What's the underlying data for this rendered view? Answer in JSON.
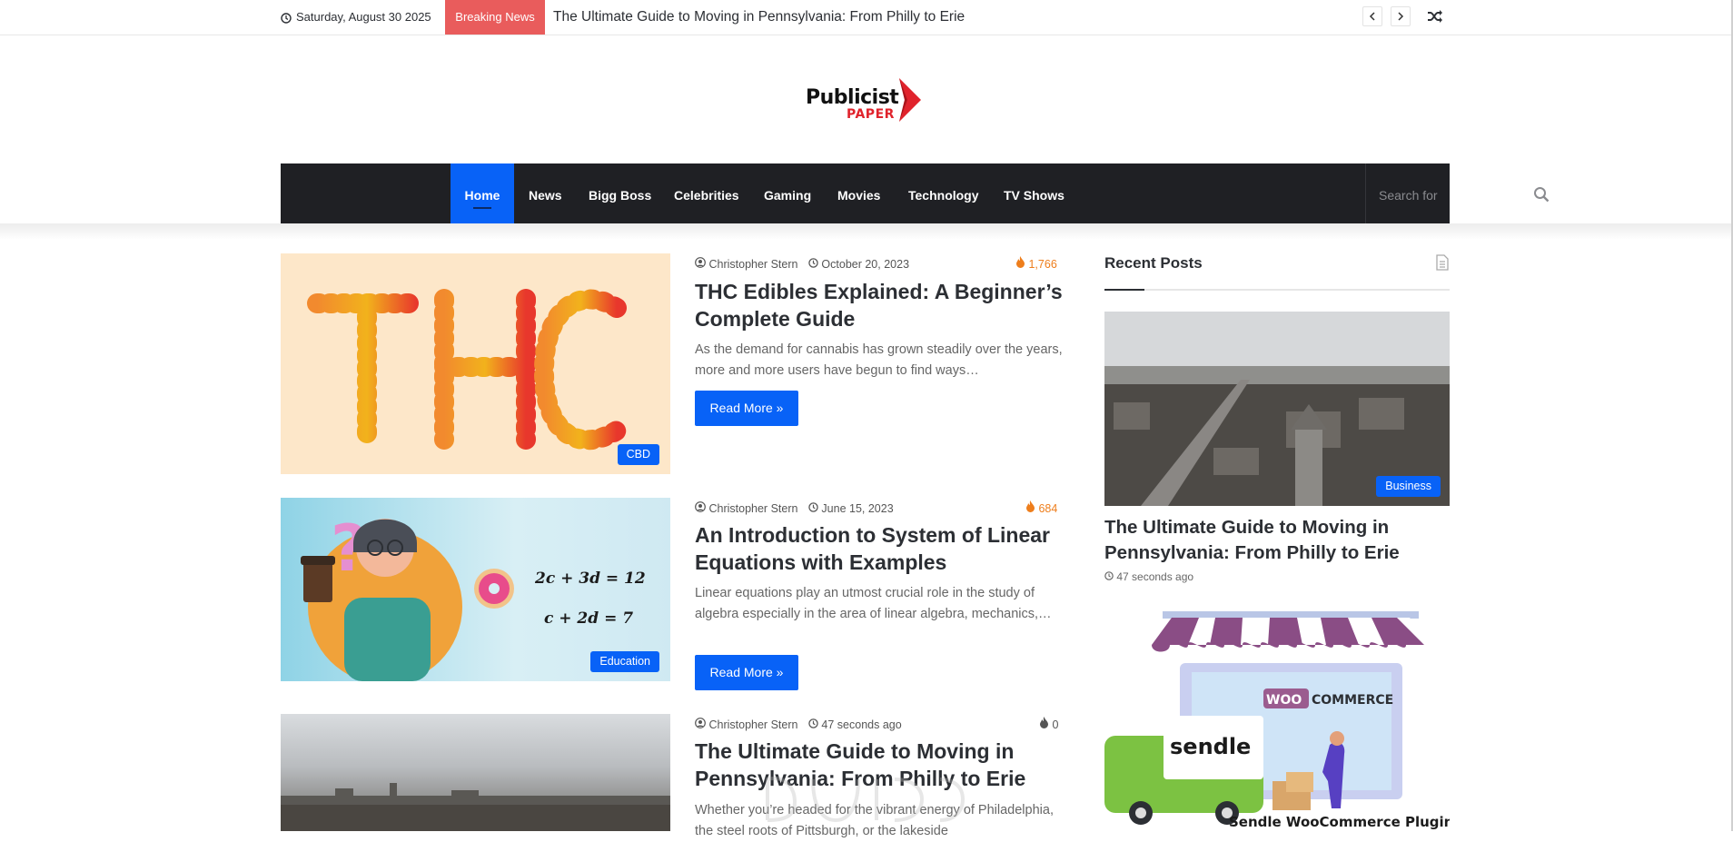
{
  "topbar": {
    "date": "Saturday, August 30 2025",
    "breaking_label": "Breaking News",
    "ticker_text": "The Ultimate Guide to Moving in Pennsylvania: From Philly to Erie"
  },
  "logo": {
    "line1": "Publicist",
    "line2": "PAPER"
  },
  "nav": {
    "items": [
      "Home",
      "News",
      "Bigg Boss",
      "Celebrities",
      "Gaming",
      "Movies",
      "Technology",
      "TV Shows"
    ],
    "search_placeholder": "Search for"
  },
  "posts": [
    {
      "author": "Christopher Stern",
      "date": "October 20, 2023",
      "views": "1,766",
      "title": "THC Edibles Explained: A Beginner’s Complete Guide",
      "excerpt": "As the demand for cannabis has grown steadily over the years, more and more users have begun to find ways…",
      "category": "CBD",
      "read_more": "Read More »",
      "image_text": "THC"
    },
    {
      "author": "Christopher Stern",
      "date": "June 15, 2023",
      "views": "684",
      "title": "An Introduction to System of Linear Equations with Examples",
      "excerpt": "Linear equations play an utmost crucial role in the study of algebra especially in the area of linear algebra, mechanics,…",
      "category": "Education",
      "read_more": "Read More »",
      "eq1": "2c + 3d = 12",
      "eq2": "c + 2d = 7"
    },
    {
      "author": "Christopher Stern",
      "date": "47 seconds ago",
      "views": "0",
      "title": "The Ultimate Guide to Moving in Pennsylvania: From Philly to Erie",
      "excerpt": "Whether you’re headed for the vibrant energy of Philadelphia, the steel roots of Pittsburgh, or the lakeside"
    }
  ],
  "sidebar": {
    "widget_title": "Recent Posts",
    "recent": {
      "category": "Business",
      "title": "The Ultimate Guide to Moving in Pennsylvania: From Philly to Erie",
      "time": "47 seconds ago"
    },
    "ad": {
      "brand1": "WOO",
      "brand1b": "COMMERCE",
      "brand2": "sendle",
      "caption": "Sendle WooCommerce Plugin:"
    }
  },
  "colors": {
    "accent": "#0862f7",
    "breaking": "#e95c5c",
    "nav_bg": "#1f2024",
    "views": "#ee7e1c"
  }
}
